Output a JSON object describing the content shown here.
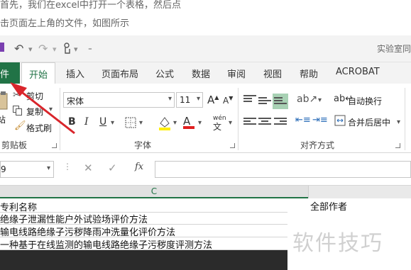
{
  "instruction": {
    "line1": "首先，我们在excel中打开一个表格，然后点",
    "line2": "击页面左上角的文件，如图所示"
  },
  "titlebar": {
    "doc_title": "实验室同"
  },
  "tabs": {
    "file": "件",
    "home": "开始",
    "insert": "插入",
    "page_layout": "页面布局",
    "formulas": "公式",
    "data": "数据",
    "review": "审阅",
    "view": "视图",
    "help": "帮助",
    "acrobat": "ACROBAT"
  },
  "ribbon": {
    "clipboard": {
      "paste": "站",
      "cut": "剪切",
      "copy": "复制",
      "format_painter": "格式刷",
      "group_label": "剪贴板"
    },
    "font": {
      "font_name": "宋体",
      "font_size": "11",
      "grow": "A",
      "shrink": "A",
      "bold": "B",
      "italic": "I",
      "underline": "U",
      "font_color_glyph": "A",
      "phonetic": "wén",
      "group_label": "字体"
    },
    "alignment": {
      "wrap_text": "自动换行",
      "merge_center": "合并后居中",
      "group_label": "对齐方式"
    }
  },
  "formula_bar": {
    "name_box": "9",
    "fx": "fx"
  },
  "sheet": {
    "column_c": "C",
    "rows": [
      "专利名称",
      "绝缘子泄漏性能户外试验场评价方法",
      "输电线路绝缘子污秽降雨冲洗量化评价方法",
      "一种基于在线监测的输电线路绝缘子污秽度评测方法"
    ],
    "column_d_cell": "全部作者"
  },
  "watermark": "软件技巧",
  "colors": {
    "excel_green": "#217346",
    "arrow_red": "#d9252b"
  }
}
